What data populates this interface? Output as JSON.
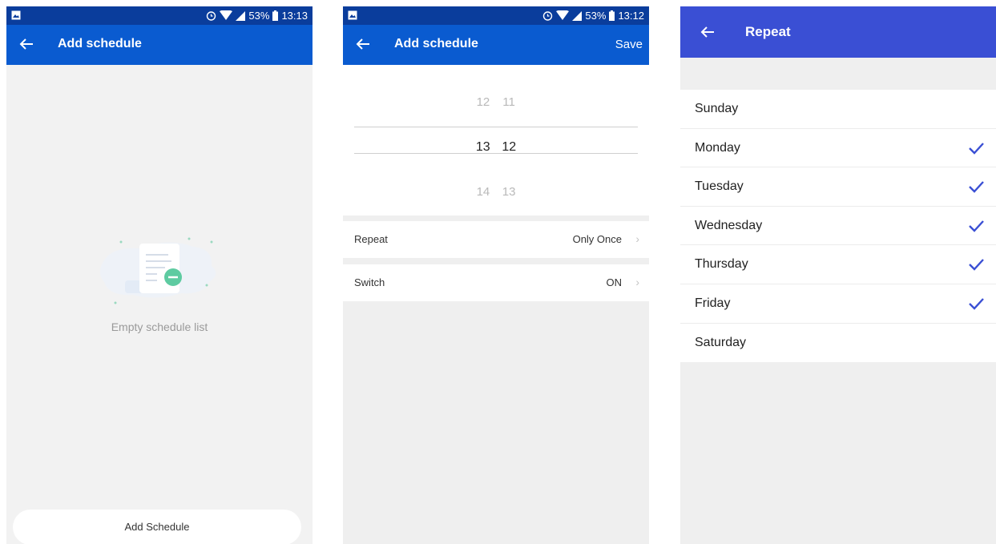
{
  "screen1": {
    "status": {
      "battery": "53%",
      "time": "13:13"
    },
    "title": "Add schedule",
    "empty_text": "Empty schedule list",
    "add_button": "Add Schedule"
  },
  "screen2": {
    "status": {
      "battery": "53%",
      "time": "13:12"
    },
    "title": "Add schedule",
    "save_label": "Save",
    "picker": {
      "above": {
        "hour": "12",
        "minute": "11"
      },
      "selected": {
        "hour": "13",
        "minute": "12"
      },
      "below": {
        "hour": "14",
        "minute": "13"
      }
    },
    "settings": [
      {
        "label": "Repeat",
        "value": "Only Once"
      },
      {
        "label": "Switch",
        "value": "ON"
      }
    ]
  },
  "screen3": {
    "title": "Repeat",
    "check_color": "#3a4fd4",
    "days": [
      {
        "name": "Sunday",
        "checked": false
      },
      {
        "name": "Monday",
        "checked": true
      },
      {
        "name": "Tuesday",
        "checked": true
      },
      {
        "name": "Wednesday",
        "checked": true
      },
      {
        "name": "Thursday",
        "checked": true
      },
      {
        "name": "Friday",
        "checked": true
      },
      {
        "name": "Saturday",
        "checked": false
      }
    ]
  }
}
